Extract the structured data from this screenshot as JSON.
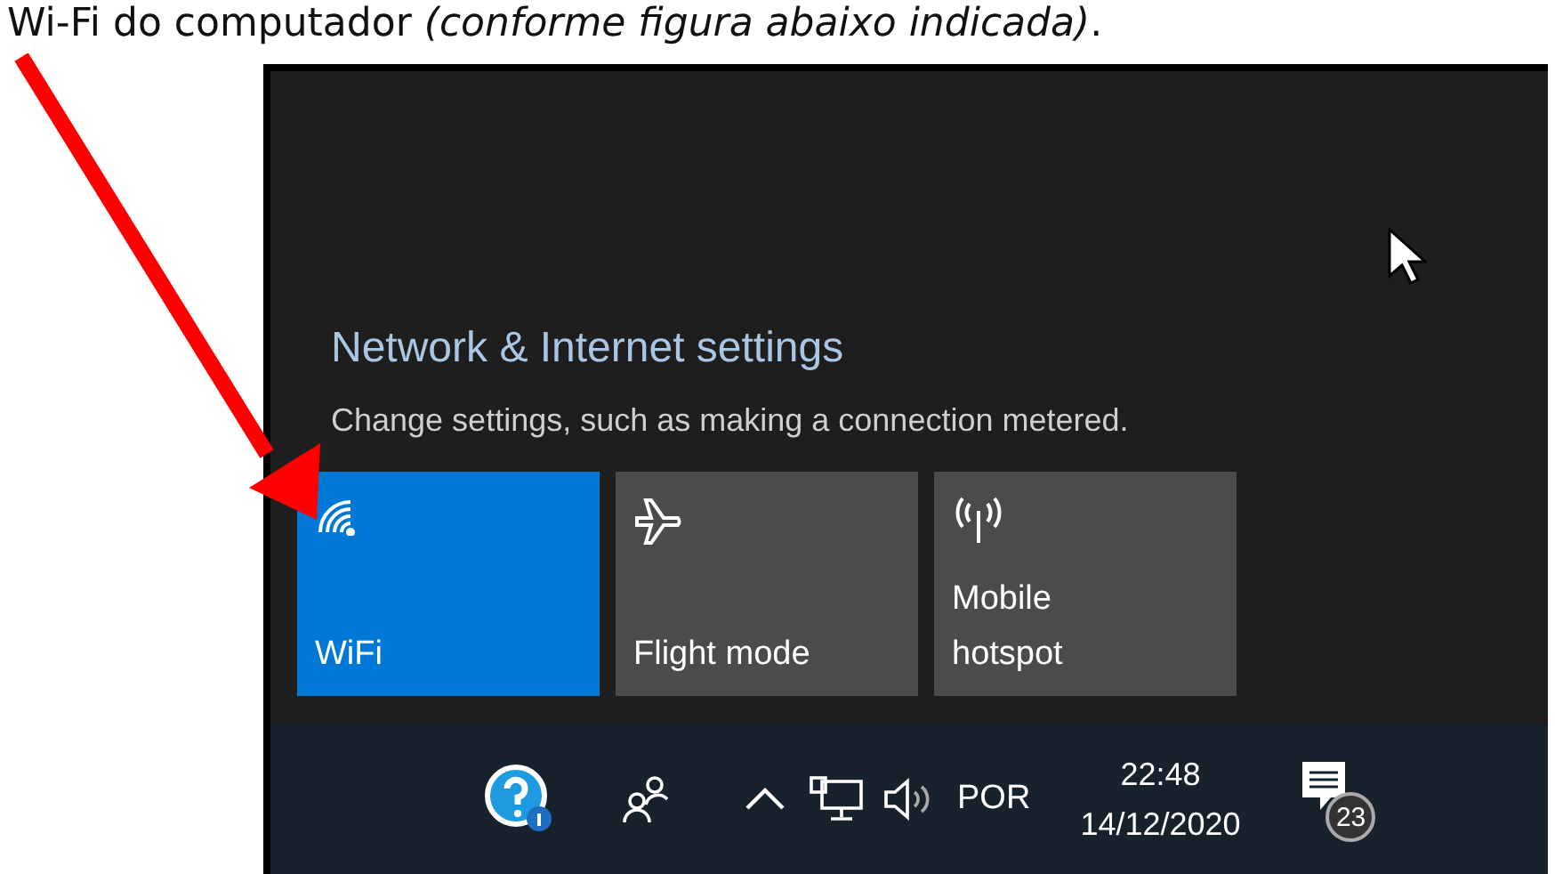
{
  "caption": "Wi-Fi do computador *(conforme figura abaixo indicada)*.",
  "panel": {
    "title": "Network & Internet settings",
    "subtitle": "Change settings, such as making a connection metered.",
    "tiles": [
      {
        "kind": "wifi",
        "label": "WiFi",
        "on": true
      },
      {
        "kind": "flight",
        "label": "Flight mode",
        "on": false
      },
      {
        "kind": "hotspot",
        "label": "Mobile hotspot",
        "on": false
      }
    ]
  },
  "taskbar": {
    "language": "POR",
    "time": "22:48",
    "date": "14/12/2020",
    "notifications": "23"
  }
}
